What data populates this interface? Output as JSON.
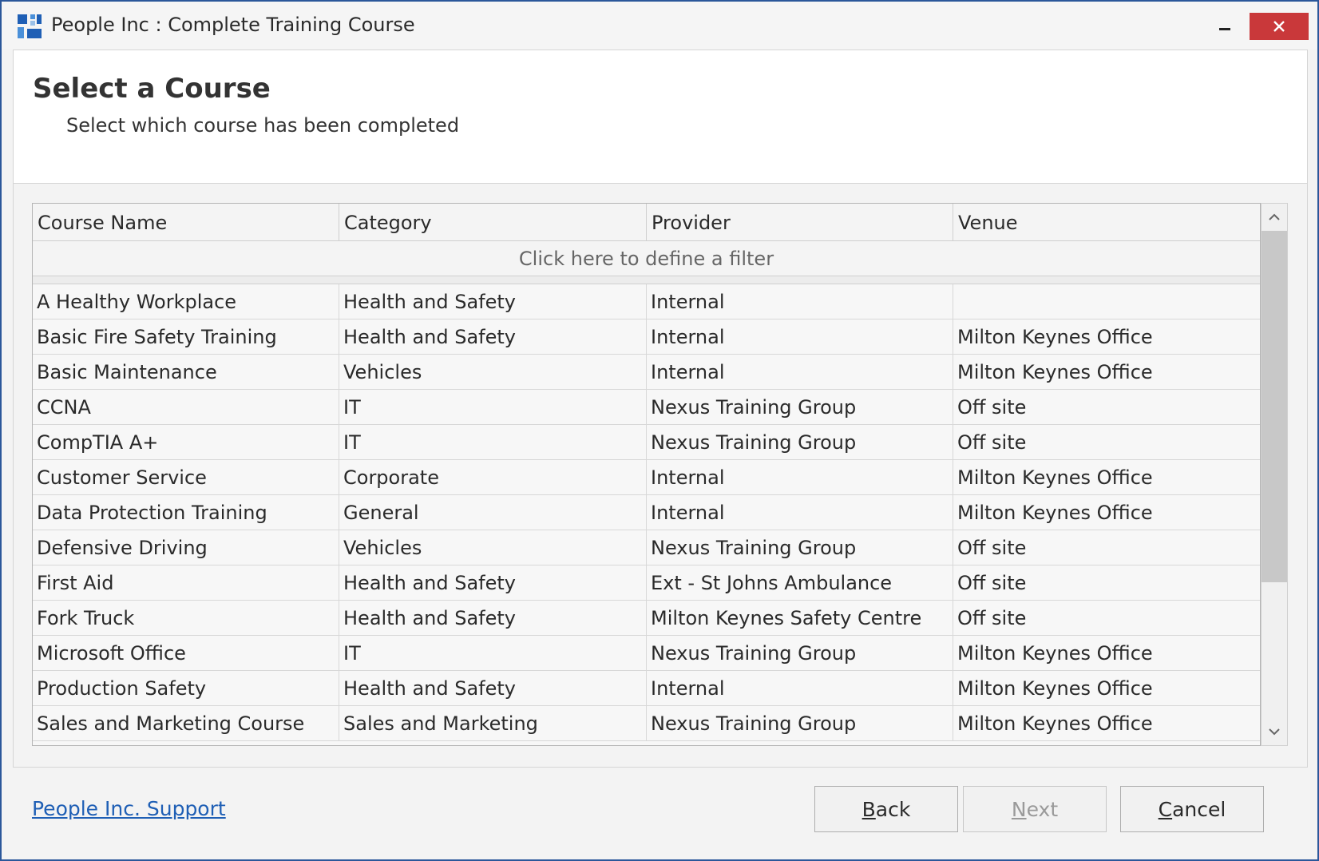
{
  "window": {
    "title": "People Inc : Complete Training Course",
    "accent_color": "#2b579a",
    "close_color": "#c9383a"
  },
  "header": {
    "title": "Select a Course",
    "subtitle": "Select which course has been completed"
  },
  "grid": {
    "columns": [
      "Course Name",
      "Category",
      "Provider",
      "Venue"
    ],
    "filter_text": "Click here to define a filter",
    "rows": [
      [
        "A Healthy Workplace",
        "Health and Safety",
        "Internal",
        ""
      ],
      [
        "Basic Fire Safety Training",
        "Health and Safety",
        "Internal",
        "Milton Keynes Office"
      ],
      [
        "Basic Maintenance",
        "Vehicles",
        "Internal",
        "Milton Keynes Office"
      ],
      [
        "CCNA",
        "IT",
        "Nexus Training Group",
        "Off site"
      ],
      [
        "CompTIA A+",
        "IT",
        "Nexus Training Group",
        "Off site"
      ],
      [
        "Customer Service",
        "Corporate",
        "Internal",
        "Milton Keynes Office"
      ],
      [
        "Data Protection Training",
        "General",
        "Internal",
        "Milton Keynes Office"
      ],
      [
        "Defensive Driving",
        "Vehicles",
        "Nexus Training Group",
        "Off site"
      ],
      [
        "First Aid",
        "Health and Safety",
        "Ext - St Johns Ambulance",
        "Off site"
      ],
      [
        "Fork Truck",
        "Health and Safety",
        "Milton Keynes Safety Centre",
        "Off site"
      ],
      [
        "Microsoft Office",
        "IT",
        "Nexus Training Group",
        "Milton Keynes Office"
      ],
      [
        "Production Safety",
        "Health and Safety",
        "Internal",
        "Milton Keynes Office"
      ],
      [
        "Sales and Marketing Course",
        "Sales and Marketing",
        "Nexus Training Group",
        "Milton Keynes Office"
      ]
    ]
  },
  "footer": {
    "support_link": "People Inc. Support",
    "back_first": "B",
    "back_rest": "ack",
    "next_first": "N",
    "next_rest": "ext",
    "cancel_first": "C",
    "cancel_rest": "ancel"
  },
  "icons": {
    "app": "app-logo-icon",
    "minimize": "minimize-icon",
    "close": "close-icon",
    "scroll_up": "chevron-up-icon",
    "scroll_down": "chevron-down-icon"
  }
}
